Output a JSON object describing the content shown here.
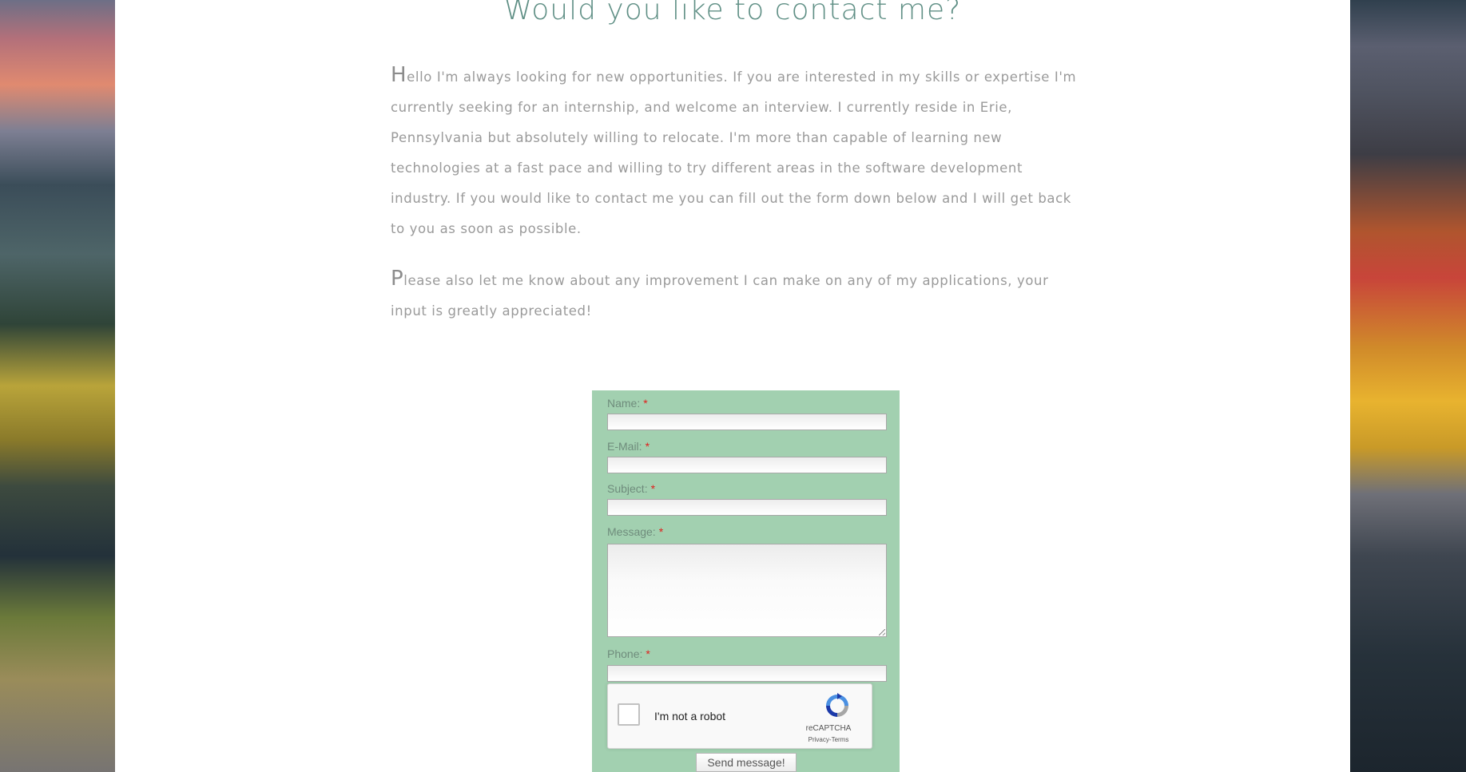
{
  "heading": "Would you like to contact me?",
  "intro": {
    "paragraph1_initial": "H",
    "paragraph1_rest": "ello I'm always looking for new opportunities. If you are interested in my skills or expertise I'm currently seeking for an internship, and welcome an interview. I currently reside in Erie, Pennsylvania but absolutely willing to relocate. I'm more than capable of learning new technologies at a fast pace and willing to try different areas in the software development industry. If you would like to contact me you can fill out the form down below and I will get back to you as soon as possible.",
    "paragraph2_initial": "P",
    "paragraph2_rest": "lease also let me know about any improvement I can make on any of my applications, your input is greatly appreciated!"
  },
  "form": {
    "required_marker": "*",
    "name_label": "Name:",
    "email_label": "E-Mail:",
    "subject_label": "Subject:",
    "message_label": "Message:",
    "phone_label": "Phone:",
    "name_value": "",
    "email_value": "",
    "subject_value": "",
    "message_value": "",
    "phone_value": "",
    "submit_label": "Send message!"
  },
  "captcha": {
    "checkbox_label": "I'm not a robot",
    "brand": "reCAPTCHA",
    "privacy_link": "Privacy",
    "separator": "-",
    "terms_link": "Terms"
  },
  "colors": {
    "heading": "#5f8f85",
    "body_text": "#9a9a9a",
    "form_background": "#a2d0b0",
    "required_marker": "#e0201d"
  },
  "icons": {
    "captcha_logo": "recaptcha-icon"
  }
}
